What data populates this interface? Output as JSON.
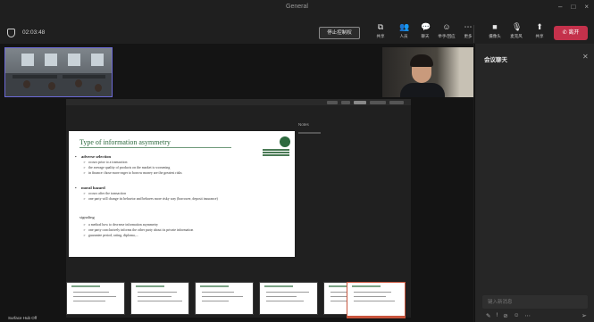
{
  "window": {
    "title": "General",
    "controls": [
      "–",
      "□",
      "×"
    ]
  },
  "meeting": {
    "timer": "02:03:48"
  },
  "toolbar": {
    "stop_share_label": "停止控制权",
    "buttons": [
      {
        "id": "share",
        "icon": "share-screen-icon",
        "glyph": "⧉",
        "label": "共享"
      },
      {
        "id": "people",
        "icon": "people-icon",
        "glyph": "👥",
        "label": "人员"
      },
      {
        "id": "chat",
        "icon": "chat-icon",
        "glyph": "💬",
        "label": "聊天"
      },
      {
        "id": "react",
        "icon": "reaction-icon",
        "glyph": "☺",
        "label": "举手/回应"
      },
      {
        "id": "more",
        "icon": "more-icon",
        "glyph": "⋯",
        "label": "更多"
      },
      {
        "id": "camera",
        "icon": "camera-icon",
        "glyph": "■",
        "label": "摄像头"
      },
      {
        "id": "mic",
        "icon": "microphone-icon",
        "glyph": "🎙",
        "label": "麦克风"
      },
      {
        "id": "sharetray",
        "icon": "share-tray-icon",
        "glyph": "⬆",
        "label": "共享"
      }
    ],
    "leave_label": "离开",
    "accent": "#c4314b"
  },
  "shared_slide": {
    "title": "Type of information asymmetry",
    "sections": [
      {
        "heading": "adverse selection",
        "lines": [
          "occurs prior to a transaction",
          "the average quality of products on the market is worsening",
          "in finance: those more eager to borrow money are the greatest risks"
        ]
      },
      {
        "heading": "moral hazard",
        "lines": [
          "occurs after the transaction",
          "one party will change its behavior and behaves more risky way (borrower, deposit insurance)"
        ]
      }
    ],
    "signaling": {
      "heading": "signaling",
      "lines": [
        "a method how to decrease information asymmetry",
        "one party conclusively informs the other party about its private information",
        "guarantee period, rating, diploma,..."
      ]
    },
    "notes_label": "Notes"
  },
  "filmstrip": {
    "count": 6,
    "active_index": 5
  },
  "device_label": "Surface Hub Off",
  "chat": {
    "title": "会议聊天",
    "input_placeholder": "键入新消息",
    "tools": [
      "✎",
      "!",
      "⊘",
      "☺",
      "⋯"
    ],
    "send": "➢"
  },
  "colors": {
    "slide_title": "#2e6a3f",
    "presenter_frame": "#6b69d6",
    "active_thumb": "#c8553d"
  }
}
